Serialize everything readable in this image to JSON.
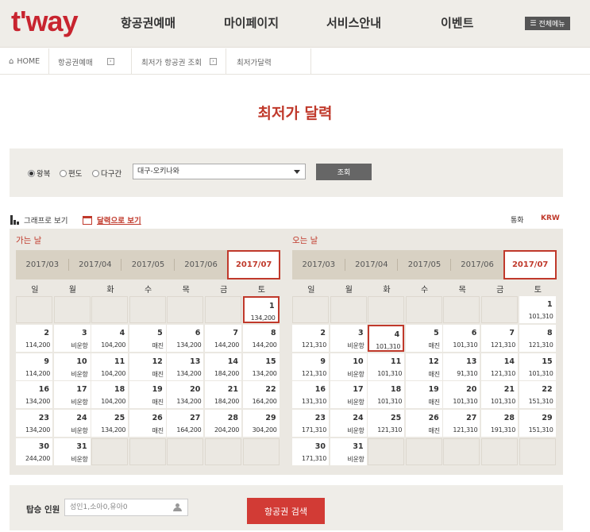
{
  "header": {
    "logo": "t'way",
    "nav": [
      "항공권예매",
      "마이페이지",
      "서비스안내",
      "이벤트"
    ],
    "all_menu": "전체메뉴"
  },
  "breadcrumb": [
    "HOME",
    "항공권예매",
    "최저가 항공권 조회",
    "최저가달력"
  ],
  "page_title": "최저가 달력",
  "search": {
    "trip_types": [
      "왕복",
      "편도",
      "다구간"
    ],
    "selected_trip": "왕복",
    "route": "대구-오키나와",
    "search_button": "조회"
  },
  "view": {
    "graph": "그래프로 보기",
    "calendar": "달력으로 보기"
  },
  "currency": {
    "label": "통화",
    "value": "KRW"
  },
  "weekdays": [
    "일",
    "월",
    "화",
    "수",
    "목",
    "금",
    "토"
  ],
  "depart": {
    "title": "가는 날",
    "months": [
      "2017/03",
      "2017/04",
      "2017/05",
      "2017/06",
      "2017/07"
    ],
    "selected_month": "2017/07",
    "selected_day": 1,
    "first_weekday": 6,
    "prices": [
      "134,200",
      "114,200",
      "비운항",
      "104,200",
      "매진",
      "134,200",
      "144,200",
      "144,200",
      "114,200",
      "비운항",
      "104,200",
      "매진",
      "134,200",
      "184,200",
      "134,200",
      "134,200",
      "비운항",
      "104,200",
      "매진",
      "134,200",
      "184,200",
      "164,200",
      "134,200",
      "비운항",
      "134,200",
      "매진",
      "164,200",
      "204,200",
      "304,200",
      "244,200",
      "비운항"
    ]
  },
  "return": {
    "title": "오는 날",
    "months": [
      "2017/03",
      "2017/04",
      "2017/05",
      "2017/06",
      "2017/07"
    ],
    "selected_month": "2017/07",
    "selected_day": 4,
    "first_weekday": 6,
    "prices": [
      "101,310",
      "121,310",
      "비운항",
      "101,310",
      "매진",
      "101,310",
      "121,310",
      "121,310",
      "121,310",
      "비운항",
      "101,310",
      "매진",
      "91,310",
      "121,310",
      "101,310",
      "131,310",
      "비운항",
      "101,310",
      "매진",
      "101,310",
      "101,310",
      "151,310",
      "171,310",
      "비운항",
      "121,310",
      "매진",
      "121,310",
      "191,310",
      "151,310",
      "171,310",
      "비운항"
    ]
  },
  "passengers": {
    "label": "탑승 인원",
    "value": "성인1,소아0,유아0"
  },
  "search_flights_button": "항공권 검색",
  "colors": {
    "brand": "#c8242f",
    "accent": "#c0392b"
  }
}
